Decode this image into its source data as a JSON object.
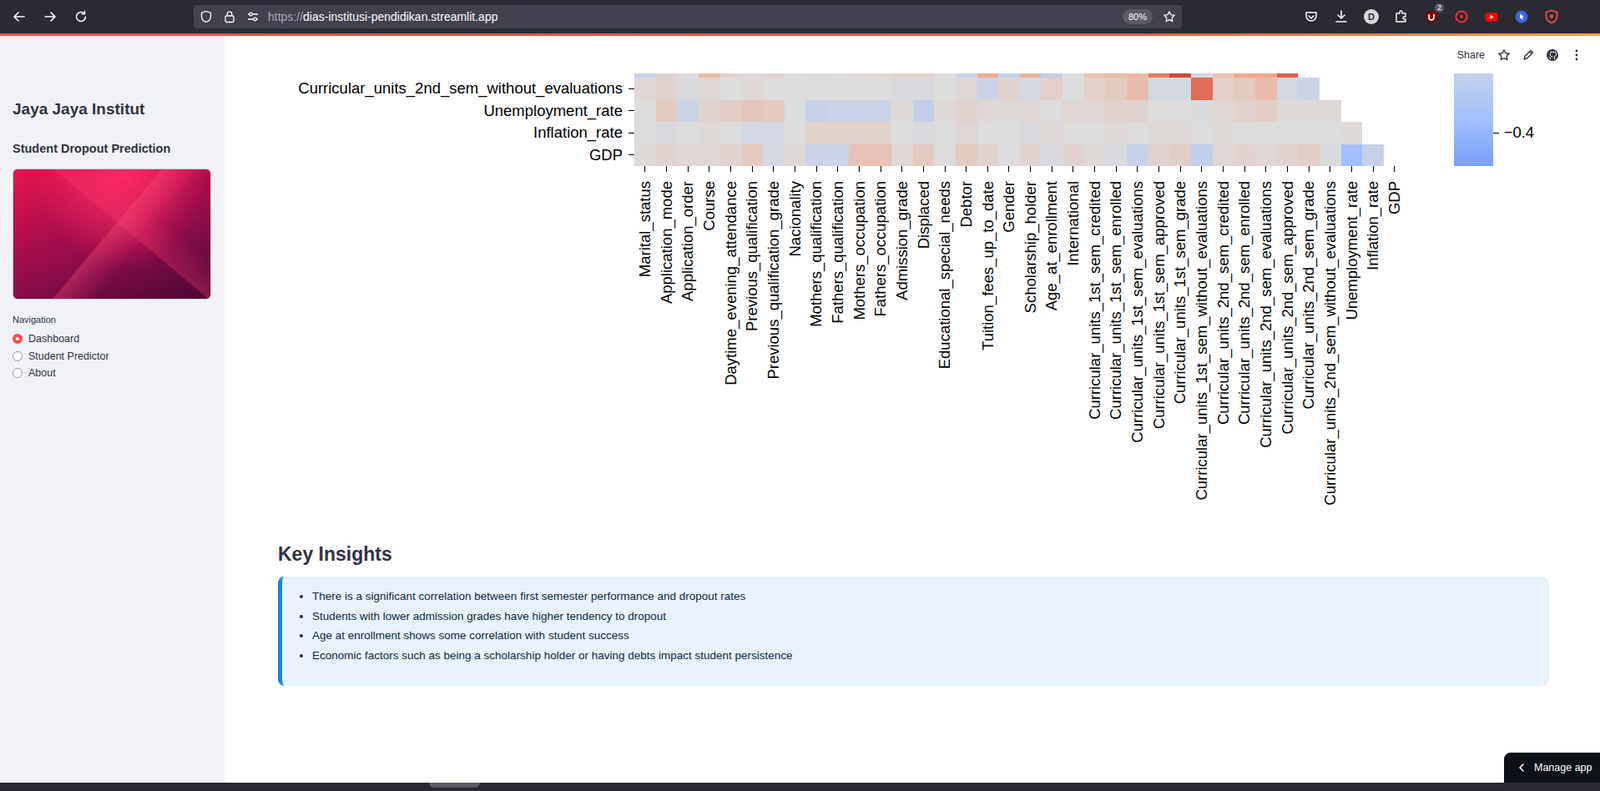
{
  "browser": {
    "url_scheme": "https://",
    "url_host": "dias-institusi-pendidikan.streamlit.app",
    "zoom": "80%",
    "extension_badge": "2",
    "avatar": "D"
  },
  "app_header": {
    "share": "Share"
  },
  "sidebar": {
    "title": "Jaya Jaya Institut",
    "subtitle": "Student Dropout Prediction",
    "navigation_label": "Navigation",
    "items": [
      {
        "label": "Dashboard",
        "selected": true
      },
      {
        "label": "Student Predictor",
        "selected": false
      },
      {
        "label": "About",
        "selected": false
      }
    ]
  },
  "heatmap": {
    "rows": [
      {
        "label": "",
        "values": [
          -0.1,
          0.05,
          0.02,
          0.2,
          0.05,
          -0.03,
          0.05,
          0,
          0.02,
          0,
          0.02,
          0.03,
          0.07,
          0.07,
          0,
          -0.1,
          0.3,
          -0.15,
          0.25,
          -0.15,
          0,
          0.15,
          0.2,
          0.2,
          0.5,
          0.7,
          -0.05,
          0.15,
          0.3,
          0.3,
          0.6
        ]
      },
      {
        "label": "Curricular_units_2nd_sem_without_evaluations",
        "values": [
          0.03,
          0.05,
          -0.03,
          0.03,
          0,
          0.03,
          0,
          0,
          0,
          0,
          0,
          0,
          -0.03,
          -0.03,
          0,
          0.03,
          -0.1,
          0.05,
          -0.05,
          0.07,
          0,
          0.07,
          0.1,
          0.18,
          -0.05,
          -0.05,
          0.55,
          0.07,
          0.1,
          0.18,
          -0.05,
          -0.1
        ]
      },
      {
        "label": "Unemployment_rate",
        "values": [
          0,
          0.1,
          -0.1,
          0.05,
          0.08,
          0.12,
          0.1,
          0,
          -0.12,
          -0.1,
          -0.1,
          -0.1,
          0.02,
          -0.15,
          0.02,
          0.05,
          0.03,
          0.02,
          0.03,
          0,
          0.03,
          0.03,
          0.05,
          0.05,
          0,
          0,
          -0.02,
          0.03,
          0.05,
          0.08,
          0.02,
          0.02,
          0.02
        ]
      },
      {
        "label": "Inflation_rate",
        "values": [
          0,
          -0.03,
          0,
          0.02,
          0,
          -0.06,
          -0.06,
          0,
          0.06,
          0.06,
          0.06,
          0.06,
          0,
          -0.02,
          0,
          0.03,
          0,
          0,
          -0.03,
          0.02,
          0,
          0,
          0.02,
          0,
          0.02,
          0.02,
          0,
          0.02,
          0,
          0,
          0,
          0,
          0,
          0.02
        ]
      },
      {
        "label": "GDP",
        "values": [
          0.02,
          0.05,
          0.03,
          0.03,
          0.05,
          0.1,
          -0.05,
          0.02,
          -0.1,
          -0.1,
          0.15,
          0.15,
          0.03,
          0.1,
          0,
          0.1,
          0.05,
          0,
          0.05,
          -0.03,
          0.05,
          0.02,
          -0.02,
          -0.12,
          0.05,
          0.08,
          -0.15,
          0.03,
          0.05,
          0.03,
          0.05,
          0.08,
          -0.02,
          -0.34,
          -0.13
        ]
      }
    ],
    "columns": [
      "Marital_status",
      "Application_mode",
      "Application_order",
      "Course",
      "Daytime_evening_attendance",
      "Previous_qualification",
      "Previous_qualification_grade",
      "Nacionality",
      "Mothers_qualification",
      "Fathers_qualification",
      "Mothers_occupation",
      "Fathers_occupation",
      "Admission_grade",
      "Displaced",
      "Educational_special_needs",
      "Debtor",
      "Tuition_fees_up_to_date",
      "Gender",
      "Scholarship_holder",
      "Age_at_enrollment",
      "International",
      "Curricular_units_1st_sem_credited",
      "Curricular_units_1st_sem_enrolled",
      "Curricular_units_1st_sem_evaluations",
      "Curricular_units_1st_sem_approved",
      "Curricular_units_1st_sem_grade",
      "Curricular_units_1st_sem_without_evaluations",
      "Curricular_units_2nd_sem_credited",
      "Curricular_units_2nd_sem_enrolled",
      "Curricular_units_2nd_sem_evaluations",
      "Curricular_units_2nd_sem_approved",
      "Curricular_units_2nd_sem_grade",
      "Curricular_units_2nd_sem_without_evaluations",
      "Unemployment_rate",
      "Inflation_rate",
      "GDP"
    ],
    "colorbar": {
      "ticks": [
        "−0.4"
      ]
    }
  },
  "insights": {
    "title": "Key Insights",
    "items": [
      "There is a significant correlation between first semester performance and dropout rates",
      "Students with lower admission grades have higher tendency to dropout",
      "Age at enrollment shows some correlation with student success",
      "Economic factors such as being a scholarship holder or having debts impact student persistence"
    ]
  },
  "manage_app": {
    "label": "Manage app"
  }
}
